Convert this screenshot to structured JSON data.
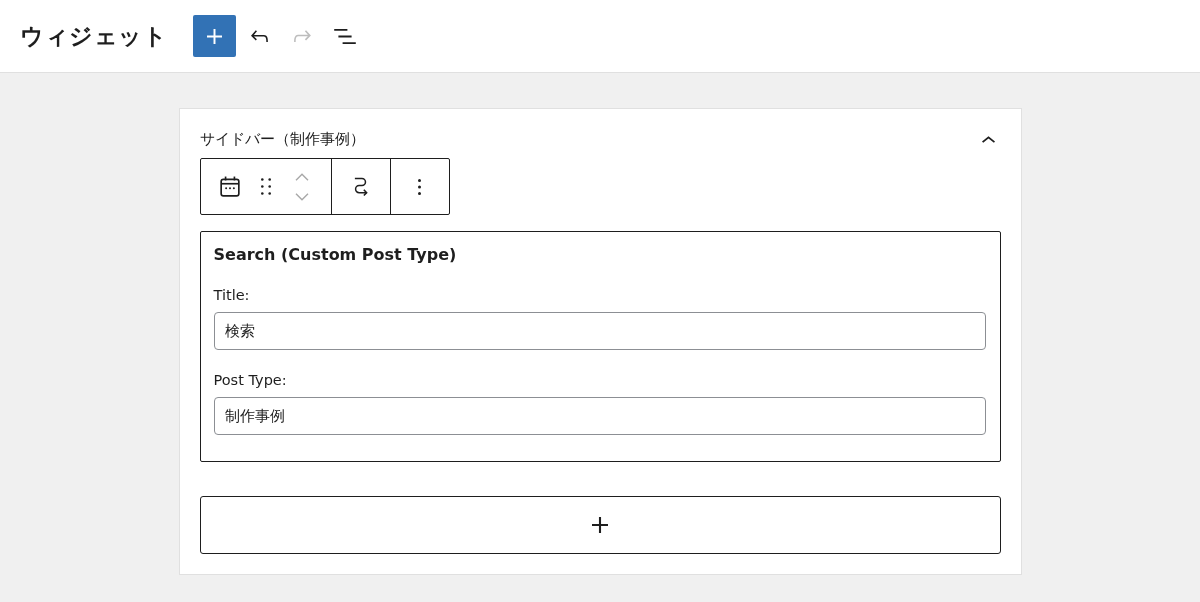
{
  "header": {
    "title": "ウィジェット",
    "tools": [
      {
        "kind": "add",
        "disabled": false
      },
      {
        "kind": "undo",
        "disabled": false
      },
      {
        "kind": "redo",
        "disabled": true
      },
      {
        "kind": "list_view",
        "disabled": false
      }
    ]
  },
  "widget_area": {
    "title": "サイドバー（制作事例）",
    "expanded": true,
    "block_toolbar": {
      "groups": [
        {
          "items": [
            {
              "kind": "block_type"
            },
            {
              "kind": "drag"
            },
            {
              "kind": "mover",
              "up_disabled": true,
              "down_disabled": true
            }
          ]
        },
        {
          "items": [
            {
              "kind": "transform"
            }
          ]
        },
        {
          "items": [
            {
              "kind": "more"
            }
          ]
        }
      ]
    },
    "widget": {
      "title": "Search (Custom Post Type)",
      "fields": [
        {
          "label": "Title:",
          "value": "検索"
        },
        {
          "label": "Post Type:",
          "value": "制作事例"
        }
      ]
    },
    "appender": {
      "kind": "add"
    }
  }
}
